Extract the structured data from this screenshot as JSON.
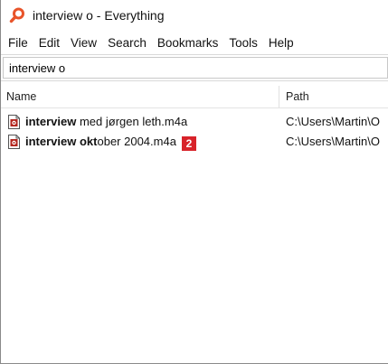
{
  "window": {
    "title": "interview o - Everything",
    "app_icon": "magnifier-icon"
  },
  "menu": [
    {
      "label": "File"
    },
    {
      "label": "Edit"
    },
    {
      "label": "View"
    },
    {
      "label": "Search"
    },
    {
      "label": "Bookmarks"
    },
    {
      "label": "Tools"
    },
    {
      "label": "Help"
    }
  ],
  "search": {
    "value": "interview o"
  },
  "columns": {
    "name": "Name",
    "path": "Path"
  },
  "results": [
    {
      "match": "interview",
      "rest": " med jørgen leth.m4a",
      "path": "C:\\Users\\Martin\\O",
      "icon": "audio-file-icon"
    },
    {
      "match": "interview",
      "mid_plain": " ",
      "mid_bold": "okt",
      "rest": "ober 2004.m4a",
      "path": "C:\\Users\\Martin\\O",
      "icon": "audio-file-icon",
      "badge": "2"
    }
  ],
  "colors": {
    "accent_icon": "#e8542a",
    "badge": "#d8232a"
  }
}
